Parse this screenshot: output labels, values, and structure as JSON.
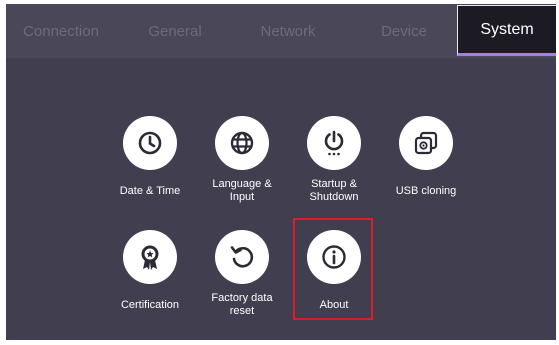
{
  "tabs": [
    {
      "label": "Connection"
    },
    {
      "label": "General"
    },
    {
      "label": "Network"
    },
    {
      "label": "Device"
    },
    {
      "label": "System",
      "active": true
    }
  ],
  "items": [
    {
      "label": "Date & Time",
      "icon": "clock-icon"
    },
    {
      "label": "Language &\nInput",
      "icon": "globe-icon"
    },
    {
      "label": "Startup &\nShutdown",
      "icon": "power-icon"
    },
    {
      "label": "USB cloning",
      "icon": "usb-cloning-icon"
    },
    {
      "label": "Certification",
      "icon": "certificate-badge-icon"
    },
    {
      "label": "Factory data\nreset",
      "icon": "reset-icon"
    },
    {
      "label": "About",
      "icon": "info-icon"
    }
  ],
  "colors": {
    "background": "#403e4f",
    "tabbar": "#4a4759",
    "active_tab": "#1c1b24",
    "accent": "#a57de8",
    "highlight": "#d61f2a"
  }
}
